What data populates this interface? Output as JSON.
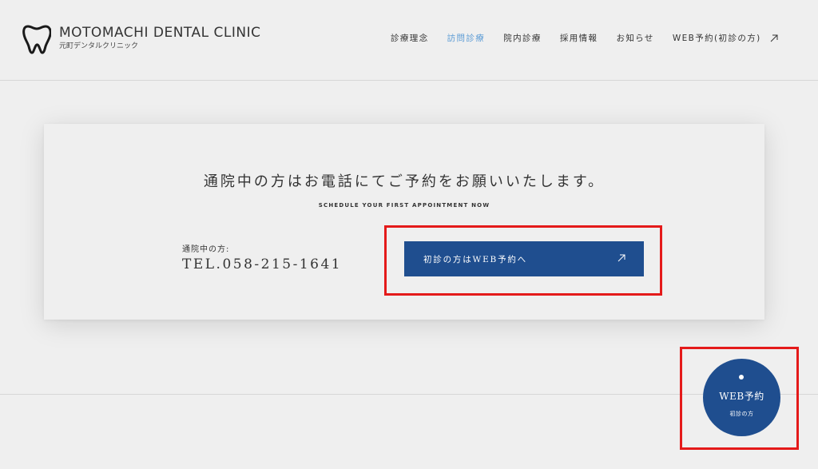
{
  "header": {
    "logo_en": "MOTOMACHI DENTAL CLINIC",
    "logo_ja": "元町デンタルクリニック",
    "logo_icon": "tooth-icon",
    "nav": [
      {
        "label": "診療理念",
        "active": false
      },
      {
        "label": "訪問診療",
        "active": true
      },
      {
        "label": "院内診療",
        "active": false
      },
      {
        "label": "採用情報",
        "active": false
      },
      {
        "label": "お知らせ",
        "active": false
      },
      {
        "label": "WEB予約(初診の方)",
        "active": false
      }
    ],
    "nav_ext_icon": "external-arrow-icon",
    "active_color": "#5b9bd5"
  },
  "card": {
    "title": "通院中の方はお電話にてご予約をお願いいたします。",
    "subtitle": "SCHEDULE YOUR FIRST APPOINTMENT NOW",
    "tel_label": "通院中の方:",
    "tel_number": "TEL.058-215-1641",
    "web_button_label": "初診の方はWEB予約へ",
    "web_button_icon": "external-arrow-icon",
    "button_color": "#1f4e8f"
  },
  "fab": {
    "label": "WEB予約",
    "sub": "初診の方"
  },
  "highlight_color": "#e41a1a"
}
